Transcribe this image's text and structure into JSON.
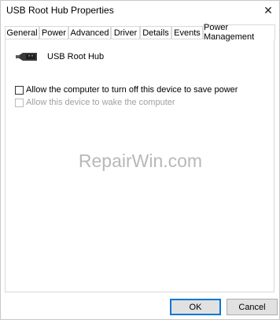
{
  "window": {
    "title": "USB Root Hub Properties",
    "close_glyph": "✕"
  },
  "tabs": [
    {
      "label": "General",
      "active": false
    },
    {
      "label": "Power",
      "active": false
    },
    {
      "label": "Advanced",
      "active": false
    },
    {
      "label": "Driver",
      "active": false
    },
    {
      "label": "Details",
      "active": false
    },
    {
      "label": "Events",
      "active": false
    },
    {
      "label": "Power Management",
      "active": true
    }
  ],
  "device": {
    "icon": "usb-plug-icon",
    "name": "USB Root Hub"
  },
  "options": [
    {
      "label": "Allow the computer to turn off this device to save power",
      "checked": false,
      "enabled": true
    },
    {
      "label": "Allow this device to wake the computer",
      "checked": false,
      "enabled": false
    }
  ],
  "watermark": "RepairWin.com",
  "buttons": {
    "ok": "OK",
    "cancel": "Cancel"
  },
  "colors": {
    "accent": "#0078d7",
    "disabled_text": "#a0a0a0",
    "watermark": "#b8b8b8"
  }
}
